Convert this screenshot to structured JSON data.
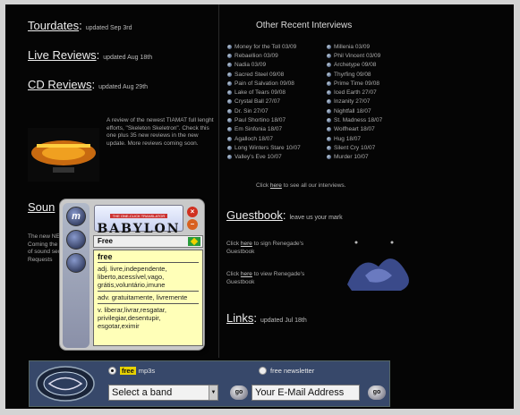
{
  "left": {
    "tourdates": {
      "title": "Tourdates",
      "updated": "updated Sep 3rd"
    },
    "live_reviews": {
      "title": "Live Reviews",
      "updated": "updated Aug 18th"
    },
    "cd_reviews": {
      "title": "CD Reviews",
      "updated": "updated Aug 29th"
    },
    "cd_text": "A review of the newest TIAMAT full lenght efforts, \"Skeleton Skeletron\". Check this one plus 35 new reviews in the new update. More reviews coming soon.",
    "sound_title": "Soun",
    "sound_text": "The new NEGAT Coming the high of sound section Requests"
  },
  "interviews": {
    "title": "Other Recent Interviews",
    "col1": [
      "Money for the Toll 03/09",
      "Rebaellion 03/09",
      "Nadia 03/09",
      "Sacred Steel 09/08",
      "Pain of Salvation 09/08",
      "Lake of Tears 09/08",
      "Crystal Ball 27/07",
      "Dr. Sin 27/07",
      "Paul Shortino 18/07",
      "Em Sinfonia 18/07",
      "Agalloch 18/07",
      "Long Winters Stare 10/07",
      "Valley's Eve 10/07"
    ],
    "col2": [
      "Millenia 03/09",
      "Phil Vincent 03/09",
      "Archetype 09/08",
      "Thyrfing 09/08",
      "Prime Time 09/08",
      "Iced Earth 27/07",
      "Inzanity 27/07",
      "Nightfall 18/07",
      "St. Madness 18/07",
      "Wolfheart 18/07",
      "Hug 18/07",
      "Silent Cry 10/07",
      "Murder 10/07"
    ],
    "see_all_pre": "Click ",
    "see_all_link": "here",
    "see_all_post": " to see all our interviews."
  },
  "guestbook": {
    "title": "Guestbook",
    "subtitle": "leave us your mark",
    "sign_pre": "Click ",
    "sign_link": "here",
    "sign_post": " to sign Renegade's Guestbook",
    "view_pre": "Click ",
    "view_link": "here",
    "view_post": " to view Renegade's Guestbook"
  },
  "links": {
    "title": "Links",
    "updated": "updated Jul 18th"
  },
  "bottombar": {
    "free_badge": "free",
    "mp3_label": "mp3s",
    "newsletter_label": "free newsletter",
    "select_band": "Select a band",
    "go1": "go",
    "email_value": "Your E-Mail Address",
    "go2": "go"
  },
  "babylon": {
    "tagline": "THE ONE-CLICK TRANSLATOR",
    "logo": "BABYLON",
    "lang": "Free",
    "word": "free",
    "defs": [
      "adj. livre,independente, liberto,acessível,vago, grátis,voluntário,imune",
      "adv. gratuitamente, livremente",
      "v. liberar,livrar,resgatar, privilegiar,desentupir, esgotar,eximir"
    ],
    "side_letter": "m"
  },
  "colors": {
    "background": "#050505",
    "bar": "#37486a",
    "popup_body": "#ffffb8"
  }
}
